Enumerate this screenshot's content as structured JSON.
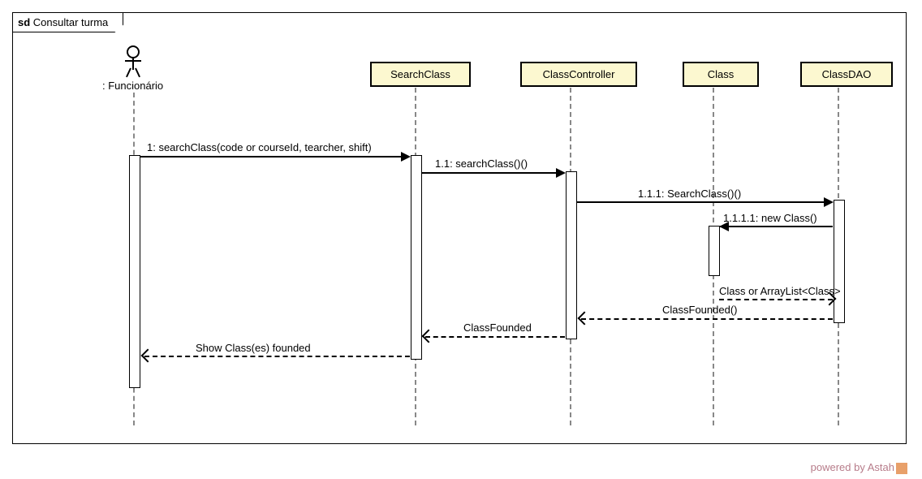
{
  "frame": {
    "prefix": "sd",
    "title": "Consultar turma"
  },
  "actor": {
    "label": ": Funcionário"
  },
  "lifelines": {
    "searchClass": "SearchClass",
    "classController": "ClassController",
    "classEntity": "Class",
    "classDAO": "ClassDAO"
  },
  "messages": {
    "m1": "1: searchClass(code or courseId, tearcher, shift)",
    "m1_1": "1.1: searchClass()()",
    "m1_1_1": "1.1.1: SearchClass()()",
    "m1_1_1_1": "1.1.1.1: new Class()",
    "r1": "Class or ArrayList<Class>",
    "r2": "ClassFounded()",
    "r3": "ClassFounded",
    "r4": "Show Class(es) founded"
  },
  "footer": "powered by Astah"
}
